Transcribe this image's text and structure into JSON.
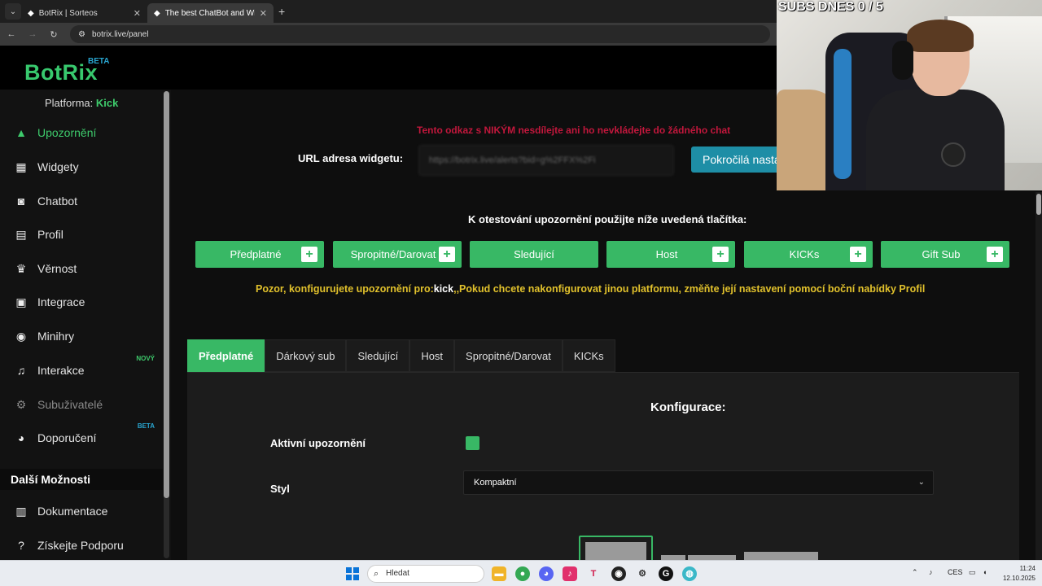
{
  "browser": {
    "tabs": [
      {
        "label": "BotRix | Sorteos",
        "active": false
      },
      {
        "label": "The best ChatBot and Widgets",
        "active": true
      }
    ],
    "url": "botrix.live/panel"
  },
  "app": {
    "logo": "BotRix",
    "logo_badge": "BETA"
  },
  "sidebar": {
    "platform_label": "Platforma:",
    "platform_value": "Kick",
    "items": [
      {
        "label": "Upozornění",
        "icon": "warning-icon",
        "active": true
      },
      {
        "label": "Widgety",
        "icon": "grid-icon"
      },
      {
        "label": "Chatbot",
        "icon": "robot-icon"
      },
      {
        "label": "Profil",
        "icon": "id-card-icon"
      },
      {
        "label": "Věrnost",
        "icon": "trophy-icon"
      },
      {
        "label": "Integrace",
        "icon": "integration-icon"
      },
      {
        "label": "Minihry",
        "icon": "gamepad-icon"
      },
      {
        "label": "Interakce",
        "icon": "music-icon",
        "badge": "NOVÝ"
      },
      {
        "label": "Subuživatelé",
        "icon": "user-gear-icon",
        "disabled": true
      },
      {
        "label": "Doporučení",
        "icon": "users-icon",
        "badge": "BETA"
      }
    ],
    "more_heading": "Další Možnosti",
    "more_items": [
      {
        "label": "Dokumentace",
        "icon": "scroll-icon"
      },
      {
        "label": "Získejte Podporu",
        "icon": "question-icon"
      }
    ]
  },
  "main": {
    "warning": "Tento odkaz s NIKÝM nesdílejte ani ho nevkládejte do žádného chat",
    "url_label": "URL adresa widgetu:",
    "url_value": "https://botrix.live/alerts?bid=g%2FFX%2Fi",
    "advanced_button": "Pokročilá nasta",
    "test_label": "K otestování upozornění použijte níže uvedená tlačítka:",
    "test_buttons": [
      {
        "label": "Předplatné",
        "plus": true
      },
      {
        "label": "Spropitné/Darovat",
        "plus": true
      },
      {
        "label": "Sledující",
        "plus": false
      },
      {
        "label": "Host",
        "plus": true
      },
      {
        "label": "KICKs",
        "plus": true
      },
      {
        "label": "Gift Sub",
        "plus": true
      }
    ],
    "config_warning_prefix": "Pozor, konfigurujete upozornění pro:",
    "config_warning_platform": "kick",
    "config_warning_suffix": ",,Pokud chcete nakonfigurovat jinou platformu, změňte její nastavení pomocí boční nabídky Profil",
    "tabs": [
      {
        "label": "Předplatné",
        "active": true
      },
      {
        "label": "Dárkový sub"
      },
      {
        "label": "Sledující"
      },
      {
        "label": "Host"
      },
      {
        "label": "Spropitné/Darovat"
      },
      {
        "label": "KICKs"
      }
    ],
    "config_title": "Konfigurace:",
    "active_label": "Aktivní upozornění",
    "active_checked": true,
    "style_label": "Styl",
    "style_value": "Kompaktní"
  },
  "webcam": {
    "overlay_text": "SUBS DNES  0 / 5"
  },
  "taskbar": {
    "search_placeholder": "Hledat",
    "language": "CES",
    "time": "11:24",
    "date": "12.10.2025"
  },
  "colors": {
    "accent_green": "#38b865",
    "accent_blue": "#1e8ea6",
    "warning_red": "#c2173c",
    "warning_yellow": "#e1c12c"
  }
}
